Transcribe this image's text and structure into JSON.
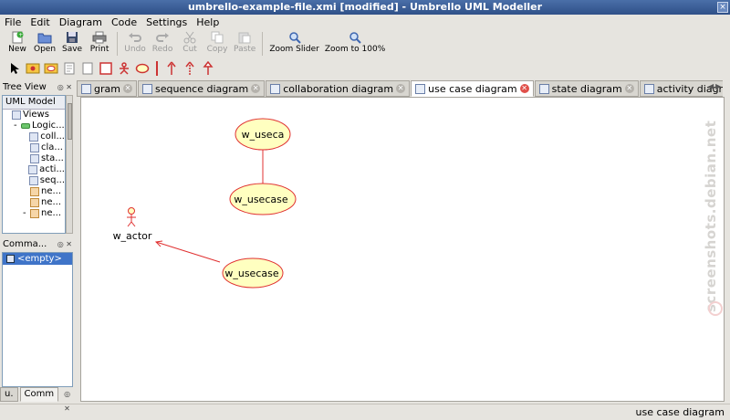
{
  "window": {
    "title": "umbrello-example-file.xmi [modified] - Umbrello UML Modeller"
  },
  "menu": [
    "File",
    "Edit",
    "Diagram",
    "Code",
    "Settings",
    "Help"
  ],
  "toolbar": {
    "new": "New",
    "open": "Open",
    "save": "Save",
    "print": "Print",
    "undo": "Undo",
    "redo": "Redo",
    "cut": "Cut",
    "copy": "Copy",
    "paste": "Paste",
    "zoom_slider": "Zoom Slider",
    "zoom_100": "Zoom to 100%"
  },
  "tree_view": {
    "title": "Tree View",
    "header": "UML Model",
    "rows": [
      {
        "label": "Views",
        "indent": 0,
        "prefix": ""
      },
      {
        "label": "Logic...",
        "indent": 1,
        "prefix": "-"
      },
      {
        "label": "coll...",
        "indent": 2,
        "prefix": ""
      },
      {
        "label": "cla...",
        "indent": 2,
        "prefix": ""
      },
      {
        "label": "sta...",
        "indent": 2,
        "prefix": ""
      },
      {
        "label": "acti...",
        "indent": 2,
        "prefix": ""
      },
      {
        "label": "seq...",
        "indent": 2,
        "prefix": ""
      },
      {
        "label": "ne...",
        "indent": 2,
        "prefix": ""
      },
      {
        "label": "ne...",
        "indent": 2,
        "prefix": ""
      },
      {
        "label": "ne...",
        "indent": 2,
        "prefix": "-"
      }
    ]
  },
  "command_history": {
    "title": "Comma...",
    "items": [
      "<empty>"
    ]
  },
  "bottom_tabs": [
    "u.",
    "Comm"
  ],
  "diagram_tabs": [
    {
      "label": "gram",
      "active": false
    },
    {
      "label": "sequence diagram",
      "active": false
    },
    {
      "label": "collaboration diagram",
      "active": false
    },
    {
      "label": "use case diagram",
      "active": true
    },
    {
      "label": "state diagram",
      "active": false
    },
    {
      "label": "activity diagram",
      "active": false
    }
  ],
  "diagram": {
    "usecase_top": "w_useca",
    "usecase_mid": "w_usecase",
    "usecase_bottom": "w_usecase",
    "actor": "w_actor"
  },
  "watermark": "screenshots.debian.net",
  "status": {
    "text": "use case diagram"
  },
  "colors": {
    "usecase_fill": "#ffffc0",
    "usecase_border": "#e03030",
    "line": "#e03030",
    "selection": "#3f74c8"
  }
}
